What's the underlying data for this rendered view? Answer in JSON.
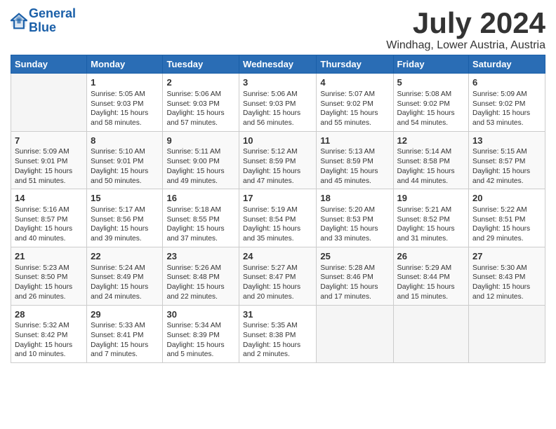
{
  "logo": {
    "line1": "General",
    "line2": "Blue"
  },
  "title": "July 2024",
  "location": "Windhag, Lower Austria, Austria",
  "weekdays": [
    "Sunday",
    "Monday",
    "Tuesday",
    "Wednesday",
    "Thursday",
    "Friday",
    "Saturday"
  ],
  "weeks": [
    [
      {
        "day": "",
        "info": ""
      },
      {
        "day": "1",
        "info": "Sunrise: 5:05 AM\nSunset: 9:03 PM\nDaylight: 15 hours\nand 58 minutes."
      },
      {
        "day": "2",
        "info": "Sunrise: 5:06 AM\nSunset: 9:03 PM\nDaylight: 15 hours\nand 57 minutes."
      },
      {
        "day": "3",
        "info": "Sunrise: 5:06 AM\nSunset: 9:03 PM\nDaylight: 15 hours\nand 56 minutes."
      },
      {
        "day": "4",
        "info": "Sunrise: 5:07 AM\nSunset: 9:02 PM\nDaylight: 15 hours\nand 55 minutes."
      },
      {
        "day": "5",
        "info": "Sunrise: 5:08 AM\nSunset: 9:02 PM\nDaylight: 15 hours\nand 54 minutes."
      },
      {
        "day": "6",
        "info": "Sunrise: 5:09 AM\nSunset: 9:02 PM\nDaylight: 15 hours\nand 53 minutes."
      }
    ],
    [
      {
        "day": "7",
        "info": "Sunrise: 5:09 AM\nSunset: 9:01 PM\nDaylight: 15 hours\nand 51 minutes."
      },
      {
        "day": "8",
        "info": "Sunrise: 5:10 AM\nSunset: 9:01 PM\nDaylight: 15 hours\nand 50 minutes."
      },
      {
        "day": "9",
        "info": "Sunrise: 5:11 AM\nSunset: 9:00 PM\nDaylight: 15 hours\nand 49 minutes."
      },
      {
        "day": "10",
        "info": "Sunrise: 5:12 AM\nSunset: 8:59 PM\nDaylight: 15 hours\nand 47 minutes."
      },
      {
        "day": "11",
        "info": "Sunrise: 5:13 AM\nSunset: 8:59 PM\nDaylight: 15 hours\nand 45 minutes."
      },
      {
        "day": "12",
        "info": "Sunrise: 5:14 AM\nSunset: 8:58 PM\nDaylight: 15 hours\nand 44 minutes."
      },
      {
        "day": "13",
        "info": "Sunrise: 5:15 AM\nSunset: 8:57 PM\nDaylight: 15 hours\nand 42 minutes."
      }
    ],
    [
      {
        "day": "14",
        "info": "Sunrise: 5:16 AM\nSunset: 8:57 PM\nDaylight: 15 hours\nand 40 minutes."
      },
      {
        "day": "15",
        "info": "Sunrise: 5:17 AM\nSunset: 8:56 PM\nDaylight: 15 hours\nand 39 minutes."
      },
      {
        "day": "16",
        "info": "Sunrise: 5:18 AM\nSunset: 8:55 PM\nDaylight: 15 hours\nand 37 minutes."
      },
      {
        "day": "17",
        "info": "Sunrise: 5:19 AM\nSunset: 8:54 PM\nDaylight: 15 hours\nand 35 minutes."
      },
      {
        "day": "18",
        "info": "Sunrise: 5:20 AM\nSunset: 8:53 PM\nDaylight: 15 hours\nand 33 minutes."
      },
      {
        "day": "19",
        "info": "Sunrise: 5:21 AM\nSunset: 8:52 PM\nDaylight: 15 hours\nand 31 minutes."
      },
      {
        "day": "20",
        "info": "Sunrise: 5:22 AM\nSunset: 8:51 PM\nDaylight: 15 hours\nand 29 minutes."
      }
    ],
    [
      {
        "day": "21",
        "info": "Sunrise: 5:23 AM\nSunset: 8:50 PM\nDaylight: 15 hours\nand 26 minutes."
      },
      {
        "day": "22",
        "info": "Sunrise: 5:24 AM\nSunset: 8:49 PM\nDaylight: 15 hours\nand 24 minutes."
      },
      {
        "day": "23",
        "info": "Sunrise: 5:26 AM\nSunset: 8:48 PM\nDaylight: 15 hours\nand 22 minutes."
      },
      {
        "day": "24",
        "info": "Sunrise: 5:27 AM\nSunset: 8:47 PM\nDaylight: 15 hours\nand 20 minutes."
      },
      {
        "day": "25",
        "info": "Sunrise: 5:28 AM\nSunset: 8:46 PM\nDaylight: 15 hours\nand 17 minutes."
      },
      {
        "day": "26",
        "info": "Sunrise: 5:29 AM\nSunset: 8:44 PM\nDaylight: 15 hours\nand 15 minutes."
      },
      {
        "day": "27",
        "info": "Sunrise: 5:30 AM\nSunset: 8:43 PM\nDaylight: 15 hours\nand 12 minutes."
      }
    ],
    [
      {
        "day": "28",
        "info": "Sunrise: 5:32 AM\nSunset: 8:42 PM\nDaylight: 15 hours\nand 10 minutes."
      },
      {
        "day": "29",
        "info": "Sunrise: 5:33 AM\nSunset: 8:41 PM\nDaylight: 15 hours\nand 7 minutes."
      },
      {
        "day": "30",
        "info": "Sunrise: 5:34 AM\nSunset: 8:39 PM\nDaylight: 15 hours\nand 5 minutes."
      },
      {
        "day": "31",
        "info": "Sunrise: 5:35 AM\nSunset: 8:38 PM\nDaylight: 15 hours\nand 2 minutes."
      },
      {
        "day": "",
        "info": ""
      },
      {
        "day": "",
        "info": ""
      },
      {
        "day": "",
        "info": ""
      }
    ]
  ]
}
